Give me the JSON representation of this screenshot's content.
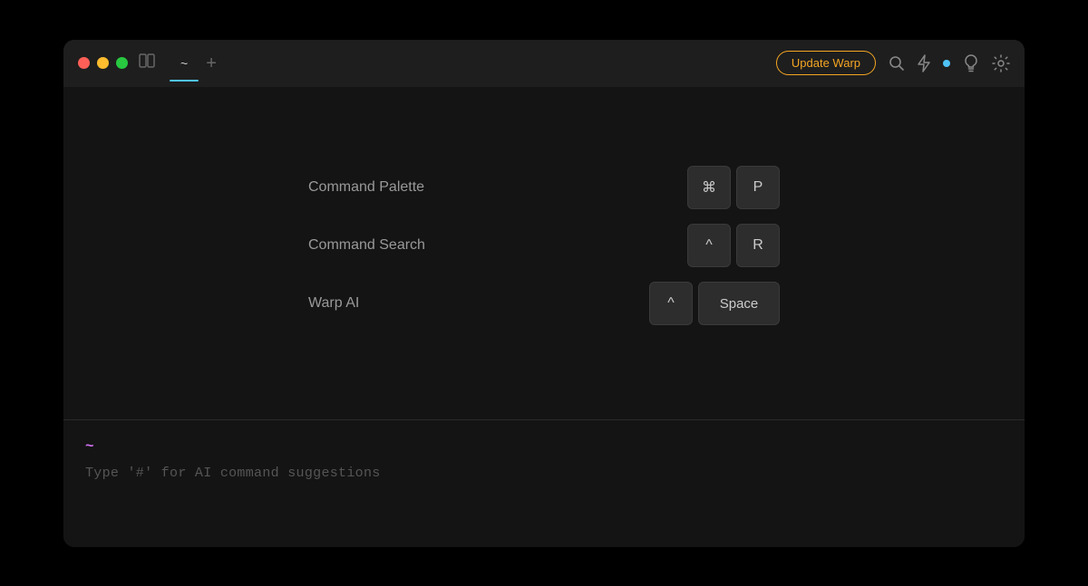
{
  "window": {
    "title": "~"
  },
  "titlebar": {
    "tab_label": "~",
    "add_tab_label": "+",
    "update_button_label": "Update Warp"
  },
  "commands": [
    {
      "label": "Command Palette",
      "key1": "⌘",
      "key2": "P"
    },
    {
      "label": "Command Search",
      "key1": "^",
      "key2": "R"
    },
    {
      "label": "Warp AI",
      "key1": "^",
      "key2": "Space"
    }
  ],
  "terminal": {
    "prompt": "~",
    "hint": "Type '#' for AI command suggestions"
  },
  "icons": {
    "split": "⊡",
    "search": "🔍",
    "bolt": "⚡",
    "bulb": "💡",
    "gear": "⚙"
  }
}
